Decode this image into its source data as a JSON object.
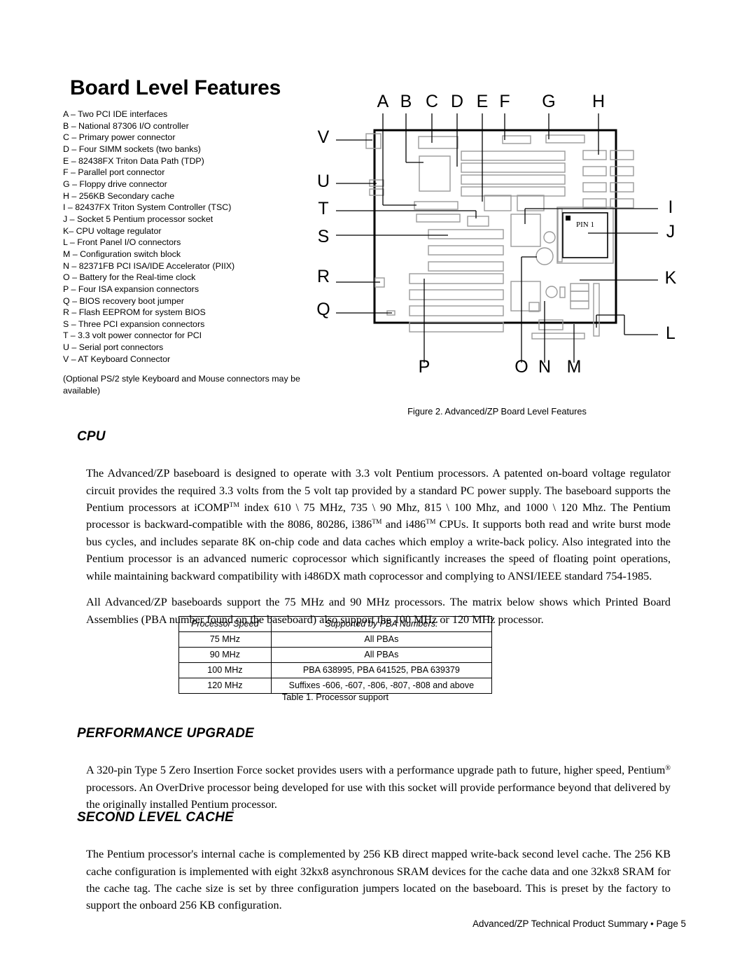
{
  "page_title": "Board Level Features",
  "legend": {
    "items": [
      "A – Two PCI IDE interfaces",
      "B – National 87306 I/O controller",
      "C – Primary power connector",
      "D – Four SIMM sockets (two banks)",
      "E – 82438FX Triton Data Path (TDP)",
      "F – Parallel port connector",
      "G – Floppy drive connector",
      "H – 256KB Secondary cache",
      "I – 82437FX Triton System Controller (TSC)",
      "J – Socket 5 Pentium processor socket",
      "K– CPU voltage regulator",
      "L – Front Panel I/O connectors",
      "M – Configuration switch block",
      "N – 82371FB PCI ISA/IDE Accelerator (PIIX)",
      "O – Battery for the Real-time clock",
      "P – Four ISA expansion connectors",
      "Q – BIOS recovery boot jumper",
      "R – Flash EEPROM for system BIOS",
      "S – Three PCI expansion connectors",
      "T – 3.3 volt power connector for PCI",
      "U – Serial port connectors",
      "V – AT Keyboard Connector"
    ],
    "note": "(Optional PS/2 style Keyboard and Mouse connectors may be available)"
  },
  "figure": {
    "caption": "Figure 2. Advanced/ZP Board Level Features",
    "pin1_label": "PIN 1",
    "callouts_top": [
      "A",
      "B",
      "C",
      "D",
      "E",
      "F",
      "G",
      "H"
    ],
    "callouts_left": [
      "V",
      "U",
      "T",
      "S",
      "R",
      "Q"
    ],
    "callouts_right": [
      "I",
      "J",
      "K",
      "L"
    ],
    "callouts_bottom": [
      "P",
      "O",
      "N",
      "M"
    ]
  },
  "sections": {
    "cpu": {
      "heading": "CPU",
      "paragraph_1_a": "The Advanced/ZP baseboard is designed to operate with 3.3 volt Pentium processors. A patented on-board voltage regulator circuit provides the required 3.3 volts from the 5 volt tap provided by a standard PC power supply. The baseboard supports the Pentium processors at iCOMP",
      "paragraph_1_b": " index 610 \\ 75 MHz, 735 \\ 90 Mhz, 815 \\ 100 Mhz, and 1000 \\ 120 Mhz. The Pentium processor is backward-compatible with the 8086, 80286, i386",
      "paragraph_1_c": " and i486",
      "paragraph_1_d": " CPUs. It supports both read and write burst mode bus cycles, and includes separate 8K on-chip code and data caches which employ a write-back policy. Also integrated into the Pentium processor is an advanced numeric coprocessor which significantly increases the speed of floating point operations, while maintaining backward compatibility with i486DX math coprocessor and complying to ANSI/IEEE standard 754-1985.",
      "paragraph_2": "All Advanced/ZP baseboards support the 75 MHz and 90 MHz processors. The matrix below shows which Printed Board Assemblies (PBA number found on the baseboard) also support the 100 MHz or 120 MHz processor."
    },
    "performance_upgrade": {
      "heading": "PERFORMANCE UPGRADE",
      "paragraph_a": "A 320-pin Type 5 Zero Insertion Force socket provides users with a performance upgrade path to future, higher speed, Pentium",
      "paragraph_b": " processors. An OverDrive processor being developed for use with this socket will provide performance beyond that delivered by the originally installed Pentium processor."
    },
    "second_level_cache": {
      "heading": "SECOND LEVEL CACHE",
      "paragraph": "The Pentium processor's internal cache is complemented by 256 KB direct mapped write-back second level cache. The 256 KB cache configuration is implemented with eight 32kx8 asynchronous SRAM devices for the cache data and one 32kx8 SRAM for the cache tag. The cache size is set by three configuration jumpers located on the baseboard. This is preset by the factory to support the onboard 256 KB configuration."
    }
  },
  "processor_table": {
    "headers": [
      "Processor Speed",
      "Supported by PBA Numbers:"
    ],
    "rows": [
      [
        "75 MHz",
        "All PBAs"
      ],
      [
        "90 MHz",
        "All PBAs"
      ],
      [
        "100 MHz",
        "PBA 638995, PBA 641525, PBA 639379"
      ],
      [
        "120 MHz",
        "Suffixes -606, -607, -806, -807, -808 and above"
      ]
    ],
    "caption": "Table 1. Processor support"
  },
  "footer": "Advanced/ZP Technical Product Summary • Page 5",
  "colors": {
    "text": "#000000",
    "background": "#ffffff",
    "board_outline": "#000000",
    "component_outline": "#9a9a9a"
  }
}
